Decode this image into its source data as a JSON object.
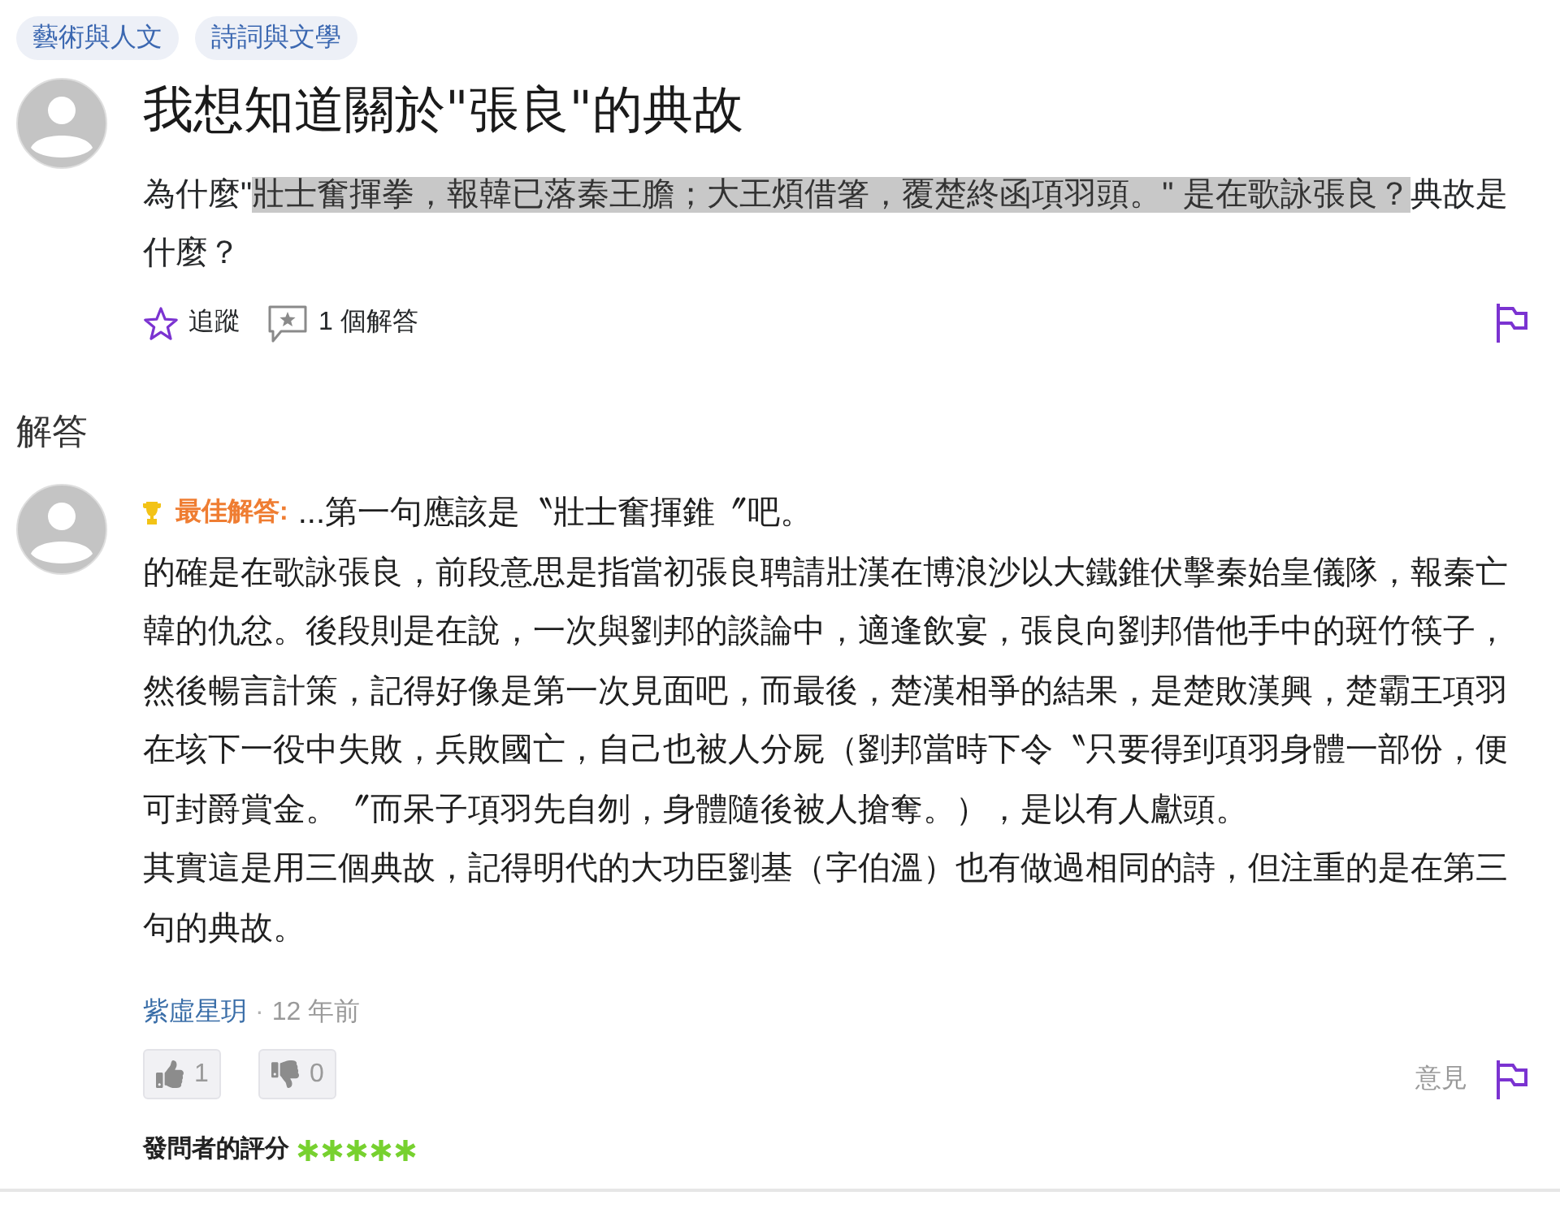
{
  "tags": [
    "藝術與人文",
    "詩詞與文學"
  ],
  "question": {
    "title": "我想知道關於\"張良\"的典故",
    "body": [
      {
        "text": "為什麼\"",
        "highlighted": false
      },
      {
        "text": "壯士奮揮拳，報韓已落秦王膽；大王煩借箸，覆楚終函項羽頭。\" 是在歌詠張良？",
        "highlighted": true
      },
      {
        "text": "典故是什麼？",
        "highlighted": false
      }
    ],
    "follow": "追蹤",
    "answer_count": "1 個解答"
  },
  "answers_heading": "解答",
  "answers": [
    {
      "badge": "最佳解答:",
      "body": [
        "...第一句應該是〝壯士奮揮錐〞吧。",
        "的確是在歌詠張良，前段意思是指當初張良聘請壯漢在博浪沙以大鐵錐伏擊秦始皇儀隊，報秦亡韓的仇忿。後段則是在說，一次與劉邦的談論中，適逢飲宴，張良向劉邦借他手中的斑竹筷子，然後暢言計策，記得好像是第一次見面吧，而最後，楚漢相爭的結果，是楚敗漢興，楚霸王項羽在垓下一役中失敗，兵敗國亡，自己也被人分屍（劉邦當時下令〝只要得到項羽身體一部份，便可封爵賞金。〞而呆子項羽先自刎，身體隨後被人搶奪。），是以有人獻頭。",
        "其實這是用三個典故，記得明代的大功臣劉基（字伯溫）也有做過相同的詩，但注重的是在第三句的典故。"
      ],
      "author": "紫虛星玥",
      "separator": "·",
      "time": "12 年前",
      "votes": [
        {
          "kind": "up",
          "count": "1"
        },
        {
          "kind": "down",
          "count": "0"
        }
      ],
      "feedback": "意見",
      "rating": {
        "label": "發問者的評分",
        "stars": 5
      }
    }
  ]
}
